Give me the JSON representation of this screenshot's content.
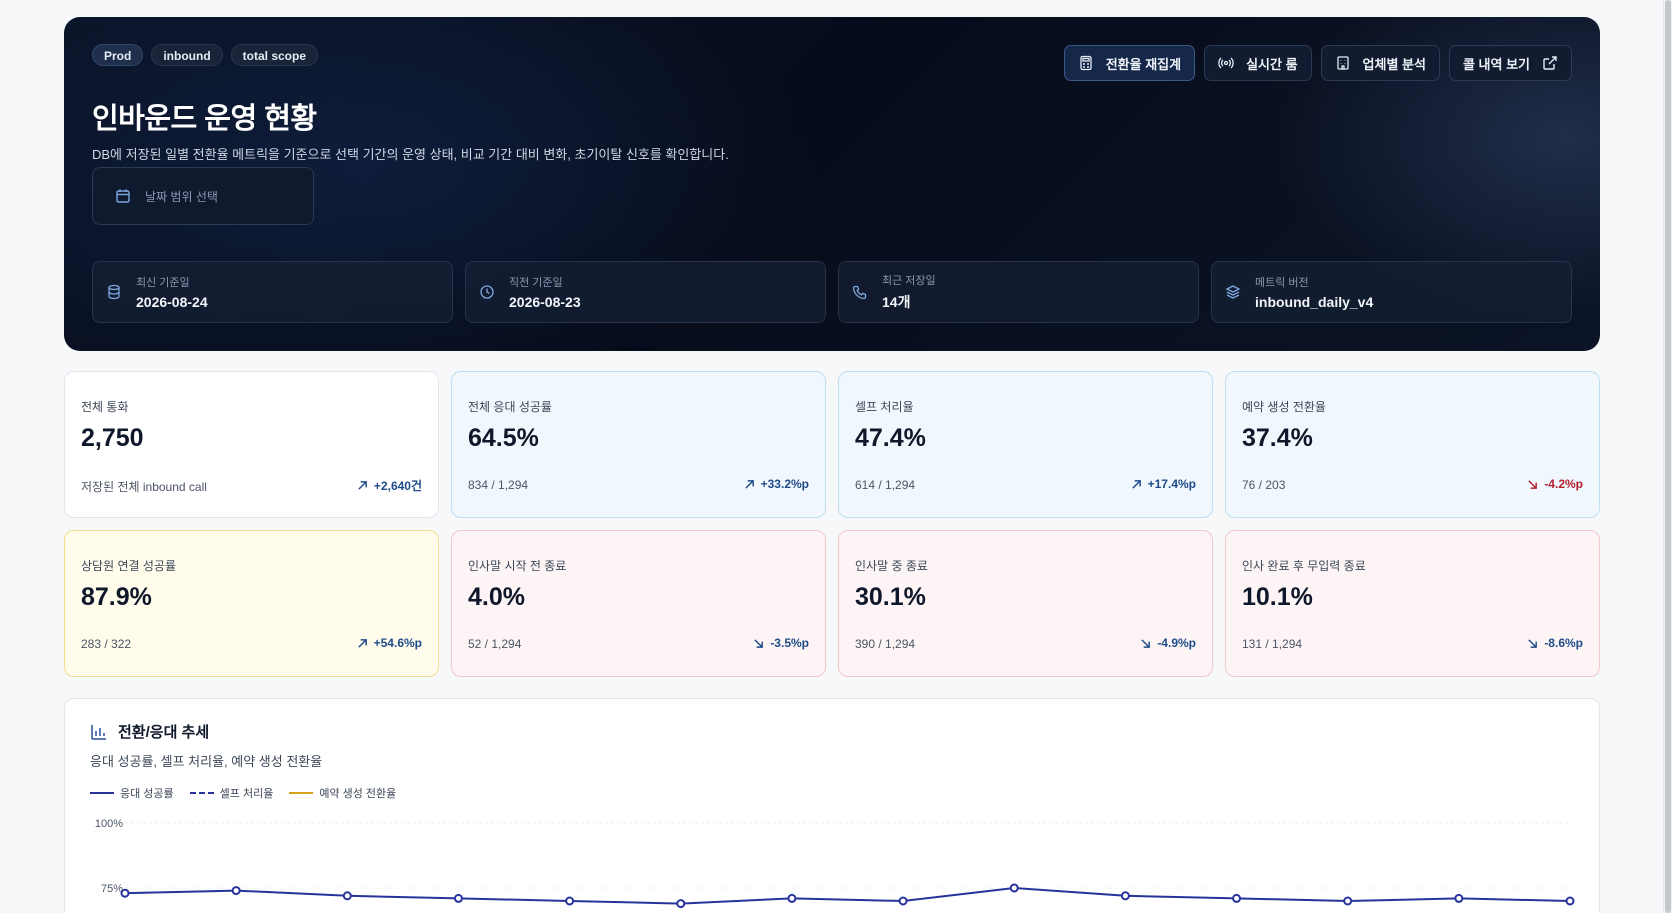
{
  "hero": {
    "badges": [
      "Prod",
      "inbound",
      "total scope"
    ],
    "title": "인바운드 운영 현황",
    "description": "DB에 저장된 일별 전환율 메트릭을 기준으로 선택 기간의 운영 상태, 비교 기간 대비 변화, 초기이탈 신호를 확인합니다.",
    "date_picker_placeholder": "날짜 범위 선택",
    "actions": {
      "recalc": "전환율 재집계",
      "realtime": "실시간 룸",
      "vendor": "업체별 분석",
      "calls": "콜 내역 보기"
    },
    "meta": [
      {
        "label": "최신 기준일",
        "value": "2026-08-24",
        "icon": "database-icon"
      },
      {
        "label": "직전 기준일",
        "value": "2026-08-23",
        "icon": "clock-icon"
      },
      {
        "label": "최근 저장일",
        "value": "14개",
        "icon": "phone-icon"
      },
      {
        "label": "메트릭 버전",
        "value": "inbound_daily_v4",
        "icon": "layers-icon"
      }
    ]
  },
  "kpis": [
    {
      "label": "전체 통화",
      "value": "2,750",
      "sub": "저장된 전체 inbound call",
      "delta": "+2,640건",
      "dir": "up",
      "tone": "white"
    },
    {
      "label": "전체 응대 성공률",
      "value": "64.5%",
      "sub": "834 / 1,294",
      "delta": "+33.2%p",
      "dir": "up",
      "tone": "blue"
    },
    {
      "label": "셀프 처리율",
      "value": "47.4%",
      "sub": "614 / 1,294",
      "delta": "+17.4%p",
      "dir": "up",
      "tone": "blue"
    },
    {
      "label": "예약 생성 전환율",
      "value": "37.4%",
      "sub": "76 / 203",
      "delta": "-4.2%p",
      "dir": "down-neg",
      "tone": "blue"
    },
    {
      "label": "상담원 연결 성공률",
      "value": "87.9%",
      "sub": "283 / 322",
      "delta": "+54.6%p",
      "dir": "up",
      "tone": "yellow"
    },
    {
      "label": "인사말 시작 전 종료",
      "value": "4.0%",
      "sub": "52 / 1,294",
      "delta": "-3.5%p",
      "dir": "down",
      "tone": "red"
    },
    {
      "label": "인사말 중 종료",
      "value": "30.1%",
      "sub": "390 / 1,294",
      "delta": "-4.9%p",
      "dir": "down",
      "tone": "red"
    },
    {
      "label": "인사 완료 후 무입력 종료",
      "value": "10.1%",
      "sub": "131 / 1,294",
      "delta": "-8.6%p",
      "dir": "down",
      "tone": "red"
    }
  ],
  "trend": {
    "title": "전환/응대 추세",
    "subtitle": "응대 성공률, 셀프 처리율, 예약 생성 전환율",
    "legend": [
      {
        "name": "응대 성공률",
        "color": "#27339b",
        "dash": false
      },
      {
        "name": "셀프 처리율",
        "color": "#27339b",
        "dash": true
      },
      {
        "name": "예약 생성 전환율",
        "color": "#d6a21a",
        "dash": false
      }
    ],
    "y_ticks": [
      "100%",
      "75%"
    ]
  },
  "chart_data": {
    "type": "line",
    "title": "전환/응대 추세",
    "ylim": [
      0,
      100
    ],
    "y_ticks": [
      100,
      75
    ],
    "series": [
      {
        "name": "응대 성공률",
        "values": [
          73,
          74,
          72,
          71,
          70,
          69,
          71,
          70,
          75,
          72,
          71,
          70,
          71,
          70
        ]
      }
    ]
  },
  "colors": {
    "hero_bg": "#070c1b",
    "accent_up": "#1f4b8a",
    "accent_neg": "#b2202f",
    "line_primary": "#27339b",
    "line_secondary": "#d6a21a"
  }
}
